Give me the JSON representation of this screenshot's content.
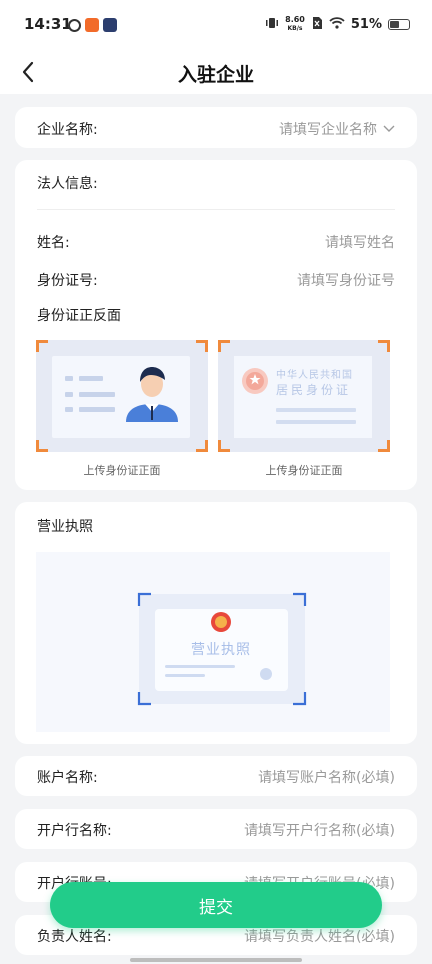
{
  "status_bar": {
    "time": "14:31",
    "net_speed_value": "8.60",
    "net_speed_unit": "KB/s",
    "battery": "51%",
    "battery_level": 0.51
  },
  "header": {
    "title": "入驻企业",
    "back_icon": "chevron-left-icon"
  },
  "company": {
    "label": "企业名称:",
    "placeholder": "请填写企业名称",
    "dropdown_icon": "chevron-down-icon"
  },
  "legal_person": {
    "section_label": "法人信息:",
    "name_label": "姓名:",
    "name_placeholder": "请填写姓名",
    "id_label": "身份证号:",
    "id_placeholder": "请填写身份证号",
    "id_photos_label": "身份证正反面",
    "front_caption": "上传身份证正面",
    "back_caption": "上传身份证正面",
    "back_card_line1": "中华人民共和国",
    "back_card_line2": "居民身份证"
  },
  "license": {
    "section_label": "营业执照",
    "card_text": "营业执照"
  },
  "account": {
    "account_name_label": "账户名称:",
    "account_name_placeholder": "请填写账户名称(必填)",
    "bank_name_label": "开户行名称:",
    "bank_name_placeholder": "请填写开户行名称(必填)",
    "bank_account_label": "开户行账号:",
    "bank_account_placeholder": "请填写开户行账号(必填)",
    "manager_label": "负责人姓名:",
    "manager_placeholder": "请填写负责人姓名(必填)"
  },
  "submit_label": "提交",
  "colors": {
    "accent": "#22cc8a",
    "corner_orange": "#f08a3c",
    "corner_blue": "#3b6fd6",
    "emblem_red": "#e8483b"
  }
}
